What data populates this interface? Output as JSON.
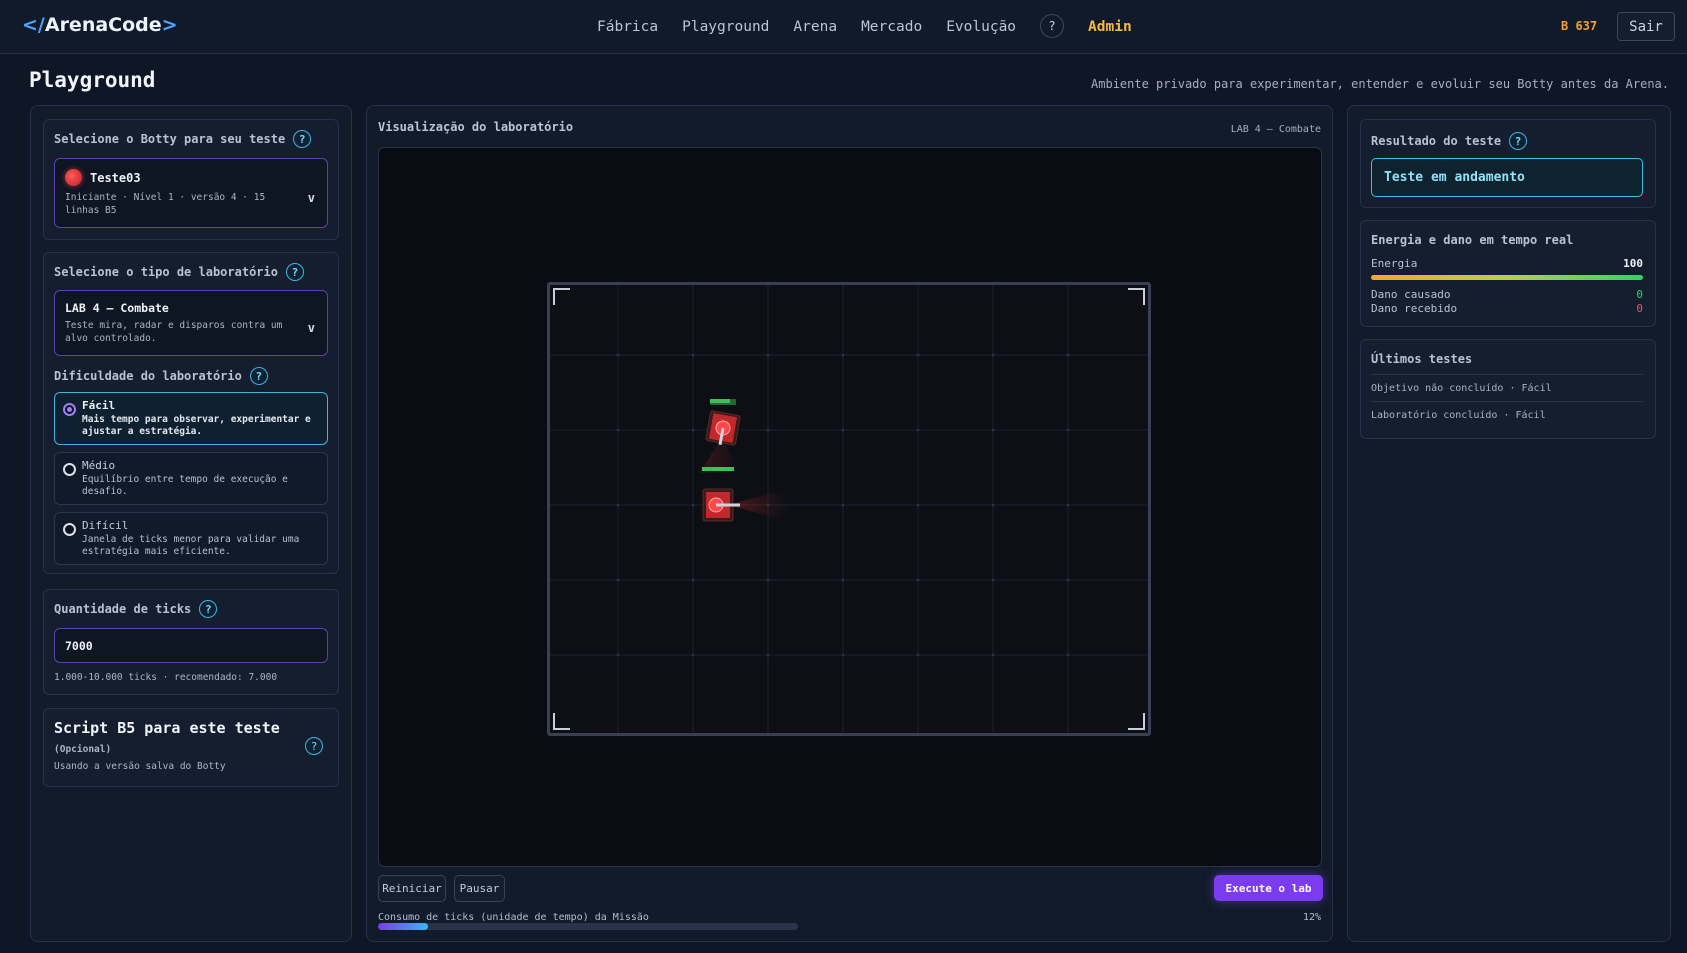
{
  "app": {
    "logo_open": "</",
    "logo_name": "ArenaCode",
    "logo_close": ">"
  },
  "nav": {
    "items": [
      "Fábrica",
      "Playground",
      "Arena",
      "Mercado",
      "Evolução"
    ],
    "help": "?",
    "admin": "Admin",
    "coins": "B 637",
    "logout": "Sair"
  },
  "page": {
    "title": "Playground",
    "subtitle": "Ambiente privado para experimentar, entender e evoluir seu Botty antes da Arena."
  },
  "left": {
    "botty_label": "Selecione o Botty para seu teste",
    "botty_name": "Teste03",
    "botty_meta": "Iniciante · Nível 1 · versão 4 · 15 linhas B5",
    "lab_label": "Selecione o tipo de laboratório",
    "lab_name": "LAB 4 — Combate",
    "lab_desc": "Teste mira, radar e disparos contra um alvo controlado.",
    "difficulty_label": "Dificuldade do laboratório",
    "difficulties": [
      {
        "title": "Fácil",
        "desc": "Mais tempo para observar, experimentar e ajustar a estratégia.",
        "selected": true
      },
      {
        "title": "Médio",
        "desc": "Equilíbrio entre tempo de execução e desafio.",
        "selected": false
      },
      {
        "title": "Difícil",
        "desc": "Janela de ticks menor para validar uma estratégia mais eficiente.",
        "selected": false
      }
    ],
    "ticks_label": "Quantidade de ticks",
    "ticks_value": "7000",
    "ticks_hint": "1.000-10.000 ticks · recomendado: 7.000",
    "script_title": "Script B5 para este teste",
    "script_optional": "(Opcional)",
    "script_note": "Usando a versão salva do Botty",
    "help": "?"
  },
  "middle": {
    "title": "Visualização do laboratório",
    "lab_tag": "LAB 4 — Combate",
    "restart": "Reiniciar",
    "pause": "Pausar",
    "run": "Execute o lab",
    "ticks_caption": "Consumo de ticks (unidade de tempo) da Missão",
    "ticks_percent": "12%",
    "ticks_progress": 0.12
  },
  "right": {
    "result_label": "Resultado do teste",
    "result_status": "Teste em andamento",
    "energy_title": "Energia e dano em tempo real",
    "energy_label": "Energia",
    "energy_value": "100",
    "energy_level": 1.0,
    "damage_dealt_label": "Dano causado",
    "damage_dealt_value": "0",
    "damage_taken_label": "Dano recebido",
    "damage_taken_value": "0",
    "history_title": "Últimos testes",
    "history": [
      "Objetivo não concluído · Fácil",
      "Laboratório concluído · Fácil"
    ],
    "help": "?"
  },
  "colors": {
    "accent_purple": "#7b3cf0",
    "accent_cyan": "#3ac0e0",
    "coins": "#f2a233",
    "admin": "#f5b841",
    "ok_green": "#35d06a",
    "bad_red": "#f05454"
  },
  "icons": [
    "help-icon",
    "chevron-down-icon",
    "botty-avatar-icon",
    "tank-icon",
    "corner-bracket-icon"
  ]
}
